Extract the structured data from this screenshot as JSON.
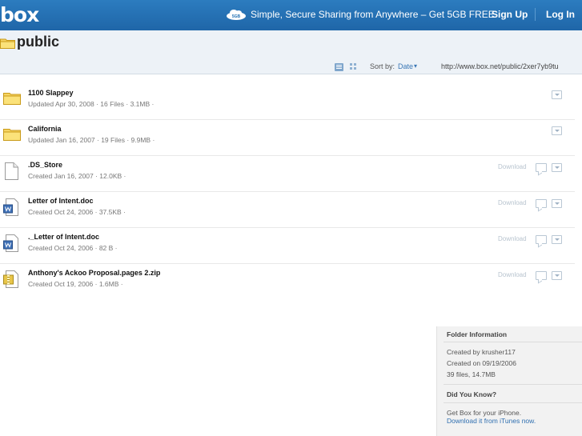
{
  "brand": {
    "logo": "box"
  },
  "topbar": {
    "promo_icon": "5GB",
    "promo_text": "Simple, Secure Sharing from Anywhere – Get 5GB FREE",
    "signup": "Sign Up",
    "login": "Log In"
  },
  "header": {
    "title": "public",
    "sort_label": "Sort by:",
    "sort_value": "Date",
    "sort_caret": "▾",
    "share_url": "http://www.box.net/public/2xer7yb9tu"
  },
  "files": [
    {
      "name": "1100 Slappey",
      "meta": "Updated Apr 30, 2008  · 16 Files · 3.1MB ·",
      "type": "folder",
      "download": ""
    },
    {
      "name": "California",
      "meta": "Updated Jan 16, 2007  · 19 Files · 9.9MB ·",
      "type": "folder",
      "download": ""
    },
    {
      "name": ".DS_Store",
      "meta": "Created Jan 16, 2007  · 12.0KB ·",
      "type": "blank",
      "download": "Download"
    },
    {
      "name": "Letter of Intent.doc",
      "meta": "Created Oct 24, 2006  · 37.5KB ·",
      "type": "doc",
      "download": "Download"
    },
    {
      "name": "._Letter of Intent.doc",
      "meta": "Created Oct 24, 2006  · 82 B ·",
      "type": "doc",
      "download": "Download"
    },
    {
      "name": "Anthony's Ackoo Proposal.pages 2.zip",
      "meta": "Created Oct 19, 2006  · 1.6MB ·",
      "type": "zip",
      "download": "Download"
    }
  ],
  "folder_info": {
    "heading": "Folder Information",
    "created_by": "Created by krusher117",
    "created_on": "Created on 09/19/2006",
    "summary": "39 files, 14.7MB",
    "did_you_know": "Did You Know?",
    "tip": "Get Box for your iPhone.",
    "tip_link": "Download it from iTunes now."
  },
  "colors": {
    "topbar": "#2170b3",
    "header": "#edf2f7",
    "link": "#2f6fb0"
  }
}
